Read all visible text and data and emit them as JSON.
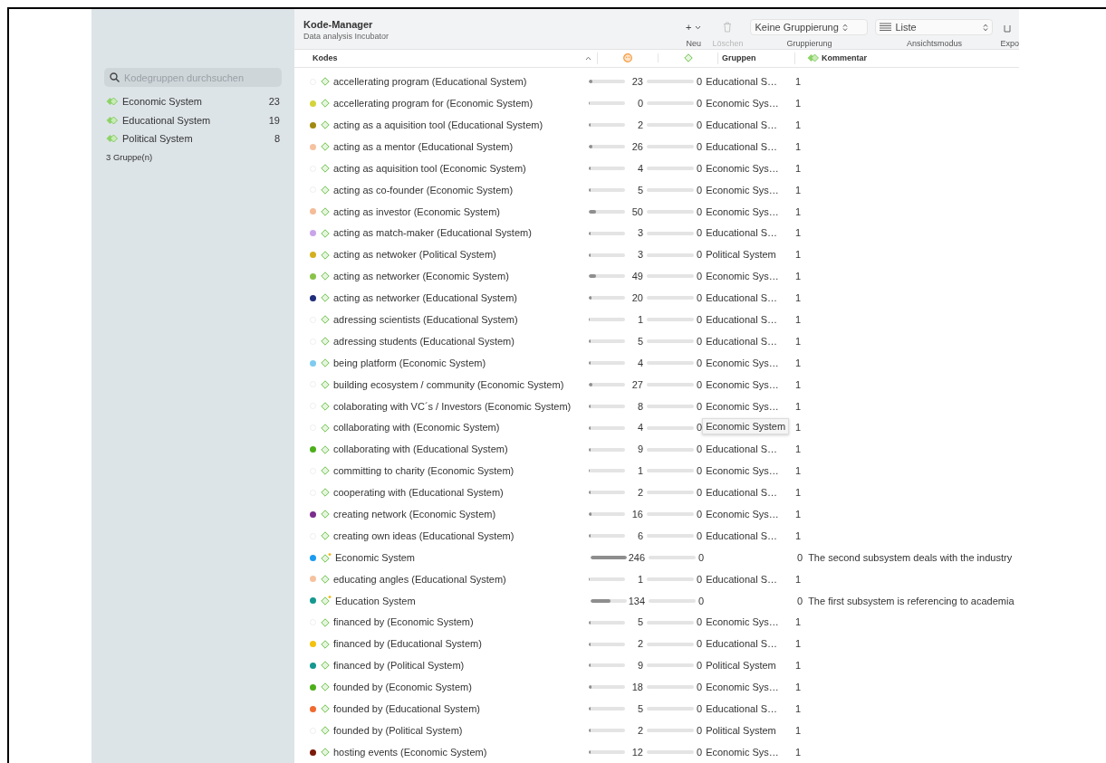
{
  "window": {
    "title": "Kode-Manager",
    "subtitle": "Data analysis Incubator"
  },
  "sidebar": {
    "search": {
      "placeholder": "Kodegruppen durchsuchen"
    },
    "items": [
      {
        "label": "Economic System",
        "count": "23"
      },
      {
        "label": "Educational System",
        "count": "19"
      },
      {
        "label": "Political System",
        "count": "8"
      }
    ],
    "footer": "3 Gruppe(n)"
  },
  "toolbar": [
    {
      "kind": "menu",
      "glyph": "+",
      "label": "Neu",
      "disabled": false
    },
    {
      "kind": "trash",
      "label": "Löschen",
      "disabled": true
    },
    {
      "kind": "select",
      "value": "Keine Gruppierung",
      "label": "Gruppierung"
    },
    {
      "kind": "list-select",
      "value": "Liste",
      "label": "Ansichtsmodus"
    },
    {
      "kind": "export",
      "label": "Expo"
    }
  ],
  "columns": [
    {
      "kind": "text",
      "label": "Kodes"
    },
    {
      "kind": "smiley"
    },
    {
      "kind": "diamond"
    },
    {
      "kind": "text",
      "label": "Gruppen"
    },
    {
      "kind": "groups-icon",
      "label": "Kommentar"
    }
  ],
  "rows": [
    {
      "kind": "code",
      "name": "accellerating program (Educational System)",
      "color": null,
      "level": 0.09,
      "count": "23",
      "count_b": "0",
      "groups": "Educational S…",
      "n": "1"
    },
    {
      "kind": "code",
      "name": "accellerating program for (Economic System)",
      "color": "#d4d43a",
      "level": 0,
      "count": "0",
      "count_b": "0",
      "groups": "Economic Sys…",
      "n": "1"
    },
    {
      "kind": "code",
      "name": "acting as a aquisition tool (Educational System)",
      "color": "#a08a10",
      "level": 0.01,
      "count": "2",
      "count_b": "0",
      "groups": "Educational S…",
      "n": "1"
    },
    {
      "kind": "code",
      "name": "acting as a mentor (Educational System)",
      "color": "#f5c2a0",
      "level": 0.11,
      "count": "26",
      "count_b": "0",
      "groups": "Educational S…",
      "n": "1"
    },
    {
      "kind": "code",
      "name": "acting as aquisition tool (Economic System)",
      "color": null,
      "level": 0.02,
      "count": "4",
      "count_b": "0",
      "groups": "Economic Sys…",
      "n": "1"
    },
    {
      "kind": "code",
      "name": "acting as co-founder (Economic System)",
      "color": null,
      "level": 0.02,
      "count": "5",
      "count_b": "0",
      "groups": "Economic Sys…",
      "n": "1"
    },
    {
      "kind": "code",
      "name": "acting as investor (Economic System)",
      "color": "#f5bc98",
      "level": 0.2,
      "count": "50",
      "count_b": "0",
      "groups": "Economic Sys…",
      "n": "1"
    },
    {
      "kind": "code",
      "name": "acting as match-maker (Educational System)",
      "color": "#c9a4ea",
      "level": 0.01,
      "count": "3",
      "count_b": "0",
      "groups": "Educational S…",
      "n": "1"
    },
    {
      "kind": "code",
      "name": "acting as netwoker (Political System)",
      "color": "#d4b020",
      "level": 0.01,
      "count": "3",
      "count_b": "0",
      "groups": "Political System",
      "n": "1"
    },
    {
      "kind": "code",
      "name": "acting as networker (Economic System)",
      "color": "#8bc34a",
      "level": 0.2,
      "count": "49",
      "count_b": "0",
      "groups": "Economic Sys…",
      "n": "1"
    },
    {
      "kind": "code",
      "name": "acting as networker (Educational System)",
      "color": "#1f2d7a",
      "level": 0.08,
      "count": "20",
      "count_b": "0",
      "groups": "Educational S…",
      "n": "1"
    },
    {
      "kind": "code",
      "name": "adressing scientists (Educational System)",
      "color": null,
      "level": 0,
      "count": "1",
      "count_b": "0",
      "groups": "Educational S…",
      "n": "1"
    },
    {
      "kind": "code",
      "name": "adressing students (Educational System)",
      "color": null,
      "level": 0.02,
      "count": "5",
      "count_b": "0",
      "groups": "Educational S…",
      "n": "1"
    },
    {
      "kind": "code",
      "name": "being platform (Economic System)",
      "color": "#7ecbef",
      "level": 0.02,
      "count": "4",
      "count_b": "0",
      "groups": "Economic Sys…",
      "n": "1"
    },
    {
      "kind": "code",
      "name": "building ecosystem / community (Economic System)",
      "color": null,
      "level": 0.11,
      "count": "27",
      "count_b": "0",
      "groups": "Economic Sys…",
      "n": "1"
    },
    {
      "kind": "code",
      "name": "colaborating with VC´s / Investors (Economic System)",
      "color": null,
      "level": 0.03,
      "count": "8",
      "count_b": "0",
      "groups": "Economic Sys…",
      "n": "1"
    },
    {
      "kind": "code",
      "name": "collaborating with (Economic System)",
      "color": null,
      "level": 0.02,
      "count": "4",
      "count_b": "0",
      "n": "1",
      "tooltip": "Economic System"
    },
    {
      "kind": "code",
      "name": "collaborating with (Educational System)",
      "color": "#4caf1a",
      "level": 0.04,
      "count": "9",
      "count_b": "0",
      "groups": "Educational S…",
      "n": "1"
    },
    {
      "kind": "code",
      "name": "committing to charity (Economic System)",
      "color": null,
      "level": 0,
      "count": "1",
      "count_b": "0",
      "groups": "Economic Sys…",
      "n": "1"
    },
    {
      "kind": "code",
      "name": "cooperating with (Educational System)",
      "color": null,
      "level": 0.01,
      "count": "2",
      "count_b": "0",
      "groups": "Educational S…",
      "n": "1"
    },
    {
      "kind": "code",
      "name": "creating network (Economic System)",
      "color": "#7b2d8e",
      "level": 0.07,
      "count": "16",
      "count_b": "0",
      "groups": "Economic Sys…",
      "n": "1"
    },
    {
      "kind": "code",
      "name": "creating own ideas (Educational System)",
      "color": null,
      "level": 0.02,
      "count": "6",
      "count_b": "0",
      "groups": "Educational S…",
      "n": "1"
    },
    {
      "kind": "group",
      "name": "Economic System",
      "color": "#1a9bf0",
      "level": 1,
      "count": "246",
      "count_b": "0",
      "n": "0",
      "comment": "The second subsystem deals with the industry"
    },
    {
      "kind": "code",
      "name": "educating angles (Educational System)",
      "color": "#f5c2a0",
      "level": 0,
      "count": "1",
      "count_b": "0",
      "groups": "Educational S…",
      "n": "1"
    },
    {
      "kind": "group",
      "name": "Education System",
      "color": "#14988f",
      "level": 0.54,
      "count": "134",
      "count_b": "0",
      "n": "0",
      "comment": "The first subsystem is referencing to academia"
    },
    {
      "kind": "code",
      "name": "financed by (Economic System)",
      "color": null,
      "level": 0.02,
      "count": "5",
      "count_b": "0",
      "groups": "Economic Sys…",
      "n": "1"
    },
    {
      "kind": "code",
      "name": "financed by (Educational System)",
      "color": "#f4c20d",
      "level": 0.01,
      "count": "2",
      "count_b": "0",
      "groups": "Educational S…",
      "n": "1"
    },
    {
      "kind": "code",
      "name": "financed by (Political System)",
      "color": "#14988f",
      "level": 0.04,
      "count": "9",
      "count_b": "0",
      "groups": "Political System",
      "n": "1"
    },
    {
      "kind": "code",
      "name": "founded by (Economic System)",
      "color": "#4caf1a",
      "level": 0.07,
      "count": "18",
      "count_b": "0",
      "groups": "Economic Sys…",
      "n": "1"
    },
    {
      "kind": "code",
      "name": "founded by (Educational System)",
      "color": "#f06a30",
      "level": 0.02,
      "count": "5",
      "count_b": "0",
      "groups": "Educational S…",
      "n": "1"
    },
    {
      "kind": "code",
      "name": "founded by (Political System)",
      "color": null,
      "level": 0.01,
      "count": "2",
      "count_b": "0",
      "groups": "Political System",
      "n": "1"
    },
    {
      "kind": "code",
      "name": "hosting events (Economic System)",
      "color": "#7a1a0a",
      "level": 0.05,
      "count": "12",
      "count_b": "0",
      "groups": "Economic Sys…",
      "n": "1"
    }
  ]
}
